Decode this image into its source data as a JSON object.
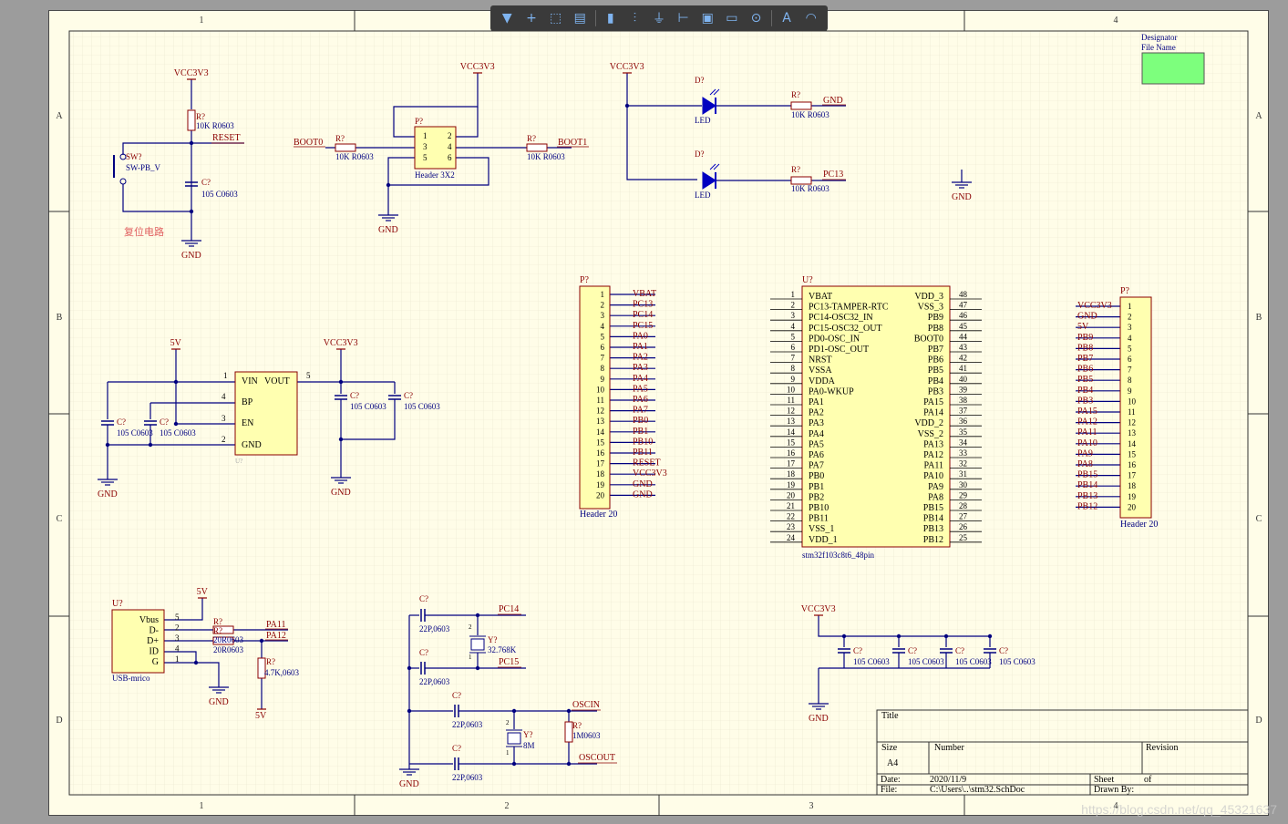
{
  "toolbar": {
    "items": [
      {
        "name": "filter-icon",
        "glyph": "▼"
      },
      {
        "name": "crosshair-icon",
        "glyph": "+"
      },
      {
        "name": "select-rect-icon",
        "glyph": "⬚"
      },
      {
        "name": "align-icon",
        "glyph": "▤"
      },
      {
        "name": "component-icon",
        "glyph": "▮"
      },
      {
        "name": "net-label-icon",
        "glyph": "⫶"
      },
      {
        "name": "gnd-port-icon",
        "glyph": "⏚"
      },
      {
        "name": "bus-icon",
        "glyph": "⊢"
      },
      {
        "name": "harness-icon",
        "glyph": "▣"
      },
      {
        "name": "port-icon",
        "glyph": "▭"
      },
      {
        "name": "no-erc-icon",
        "glyph": "⊙"
      },
      {
        "name": "text-icon",
        "glyph": "A"
      },
      {
        "name": "arc-icon",
        "glyph": "◠"
      }
    ]
  },
  "border": {
    "cols": [
      "1",
      "2",
      "3",
      "4"
    ],
    "rows": [
      "A",
      "B",
      "C",
      "D"
    ]
  },
  "titleblock": {
    "title": "Title",
    "size_label": "Size",
    "size_value": "A4",
    "number_label": "Number",
    "revision_label": "Revision",
    "date_label": "Date:",
    "date_value": "2020/11/9",
    "file_label": "File:",
    "file_value": "C:\\Users\\..\\stm32.SchDoc",
    "sheet_label": "Sheet",
    "of_label": "of",
    "drawn_label": "Drawn By:"
  },
  "designator_box": {
    "line1": "Designator",
    "line2": "File Name"
  },
  "reset": {
    "vcc": "VCC3V3",
    "r_des": "R?",
    "r_val": "10K R0603",
    "net": "RESET",
    "sw_des": "SW?",
    "sw_val": "SW-PB_V",
    "c_des": "C?",
    "c_val": "105 C0603",
    "gnd": "GND",
    "note": "复位电路"
  },
  "boot": {
    "vcc": "VCC3V3",
    "hdr_des": "P?",
    "hdr_val": "Header 3X2",
    "pins": [
      "1",
      "2",
      "3",
      "4",
      "5",
      "6"
    ],
    "boot0": "BOOT0",
    "boot1": "BOOT1",
    "r1_des": "R?",
    "r1_val": "10K R0603",
    "r2_des": "R?",
    "r2_val": "10K R0603",
    "gnd": "GND"
  },
  "leds": {
    "vcc": "VCC3V3",
    "d1_des": "D?",
    "d1_val": "LED",
    "r1_des": "R?",
    "r1_val": "10K R0603",
    "r1_net": "GND",
    "d2_des": "D?",
    "d2_val": "LED",
    "r2_des": "R?",
    "r2_val": "10K R0603",
    "r2_net": "PC13",
    "gnd": "GND"
  },
  "ldo": {
    "vin": "5V",
    "vout": "VCC3V3",
    "pins": [
      "VIN",
      "VOUT",
      "BP",
      "EN",
      "GND"
    ],
    "pin_nums": [
      "1",
      "5",
      "4",
      "3",
      "2"
    ],
    "u_des": "U?",
    "c1": "C?",
    "c1v": "105 C0603",
    "c2": "C?",
    "c2v": "105 C0603",
    "c3": "C?",
    "c3v": "105 C0603",
    "c4": "C?",
    "c4v": "105 C0603",
    "gnd1": "GND",
    "gnd2": "GND"
  },
  "hdr_left": {
    "des": "P?",
    "val": "Header 20",
    "nums": [
      "1",
      "2",
      "3",
      "4",
      "5",
      "6",
      "7",
      "8",
      "9",
      "10",
      "11",
      "12",
      "13",
      "14",
      "15",
      "16",
      "17",
      "18",
      "19",
      "20"
    ],
    "nets": [
      "VBAT",
      "PC13",
      "PC14",
      "PC15",
      "PA0",
      "PA1",
      "PA2",
      "PA3",
      "PA4",
      "PA5",
      "PA6",
      "PA7",
      "PB0",
      "PB1",
      "PB10",
      "PB11",
      "RESET",
      "VCC3V3",
      "GND",
      "GND"
    ]
  },
  "mcu": {
    "des": "U?",
    "val": "stm32f103c8t6_48pin",
    "left": [
      [
        "1",
        "VBAT"
      ],
      [
        "2",
        "PC13-TAMPER-RTC"
      ],
      [
        "3",
        "PC14-OSC32_IN"
      ],
      [
        "4",
        "PC15-OSC32_OUT"
      ],
      [
        "5",
        "PD0-OSC_IN"
      ],
      [
        "6",
        "PD1-OSC_OUT"
      ],
      [
        "7",
        "NRST"
      ],
      [
        "8",
        "VSSA"
      ],
      [
        "9",
        "VDDA"
      ],
      [
        "10",
        "PA0-WKUP"
      ],
      [
        "11",
        "PA1"
      ],
      [
        "12",
        "PA2"
      ],
      [
        "13",
        "PA3"
      ],
      [
        "14",
        "PA4"
      ],
      [
        "15",
        "PA5"
      ],
      [
        "16",
        "PA6"
      ],
      [
        "17",
        "PA7"
      ],
      [
        "18",
        "PB0"
      ],
      [
        "19",
        "PB1"
      ],
      [
        "20",
        "PB2"
      ],
      [
        "21",
        "PB10"
      ],
      [
        "22",
        "PB11"
      ],
      [
        "23",
        "VSS_1"
      ],
      [
        "24",
        "VDD_1"
      ]
    ],
    "right": [
      [
        "48",
        "VDD_3"
      ],
      [
        "47",
        "VSS_3"
      ],
      [
        "46",
        "PB9"
      ],
      [
        "45",
        "PB8"
      ],
      [
        "44",
        "BOOT0"
      ],
      [
        "43",
        "PB7"
      ],
      [
        "42",
        "PB6"
      ],
      [
        "41",
        "PB5"
      ],
      [
        "40",
        "PB4"
      ],
      [
        "39",
        "PB3"
      ],
      [
        "38",
        "PA15"
      ],
      [
        "37",
        "PA14"
      ],
      [
        "36",
        "VDD_2"
      ],
      [
        "35",
        "VSS_2"
      ],
      [
        "34",
        "PA13"
      ],
      [
        "33",
        "PA12"
      ],
      [
        "32",
        "PA11"
      ],
      [
        "31",
        "PA10"
      ],
      [
        "30",
        "PA9"
      ],
      [
        "29",
        "PA8"
      ],
      [
        "28",
        "PB15"
      ],
      [
        "27",
        "PB14"
      ],
      [
        "26",
        "PB13"
      ],
      [
        "25",
        "PB12"
      ]
    ]
  },
  "hdr_right": {
    "des": "P?",
    "val": "Header 20",
    "nums": [
      "1",
      "2",
      "3",
      "4",
      "5",
      "6",
      "7",
      "8",
      "9",
      "10",
      "11",
      "12",
      "13",
      "14",
      "15",
      "16",
      "17",
      "18",
      "19",
      "20"
    ],
    "nets": [
      "VCC3V3",
      "GND",
      "5V",
      "PB9",
      "PB8",
      "PB7",
      "PB6",
      "PB5",
      "PB4",
      "PB3",
      "PA15",
      "PA12",
      "PA11",
      "PA10",
      "PA9",
      "PA8",
      "PB15",
      "PB14",
      "PB13",
      "PB12"
    ]
  },
  "usb": {
    "des": "U?",
    "val": "USB-mrico",
    "pins": [
      "Vbus",
      "D-",
      "D+",
      "ID",
      "G"
    ],
    "nums": [
      "5",
      "2",
      "3",
      "4",
      "1"
    ],
    "v5": "5V",
    "r1": "R?",
    "r1v": "20R0603",
    "r2": "R?",
    "r2v": "20R0603",
    "net1": "PA11",
    "net2": "PA12",
    "r3": "R?",
    "r3v": "4.7K,0603",
    "v5b": "5V",
    "gnd": "GND"
  },
  "osc": {
    "c1": "C?",
    "c1v": "22P,0603",
    "c2": "C?",
    "c2v": "22P,0603",
    "y1": "Y?",
    "y1v": "32.768K",
    "n1": "PC14",
    "n2": "PC15",
    "c3": "C?",
    "c3v": "22P,0603",
    "c4": "C?",
    "c4v": "22P,0603",
    "y2": "Y?",
    "y2v": "8M",
    "r": "R?",
    "rv": "1M0603",
    "n3": "OSCIN",
    "n4": "OSCOUT",
    "gnd": "GND",
    "pin1": "1",
    "pin2": "2"
  },
  "decoup": {
    "vcc": "VCC3V3",
    "caps": [
      [
        "C?",
        "105 C0603"
      ],
      [
        "C?",
        "105 C0603"
      ],
      [
        "C?",
        "105 C0603"
      ],
      [
        "C?",
        "105 C0603"
      ]
    ],
    "gnd": "GND"
  },
  "gnd_lone": "GND",
  "watermark": "https://blog.csdn.net/qq_45321637",
  "colors": {
    "sheet": "#fffde8",
    "wire": "#000080",
    "comp_fill": "#ffffb0",
    "comp_border": "#8b0000",
    "net_label": "#8b0000",
    "text_blue": "#000080",
    "led_blue": "#0000c0"
  }
}
